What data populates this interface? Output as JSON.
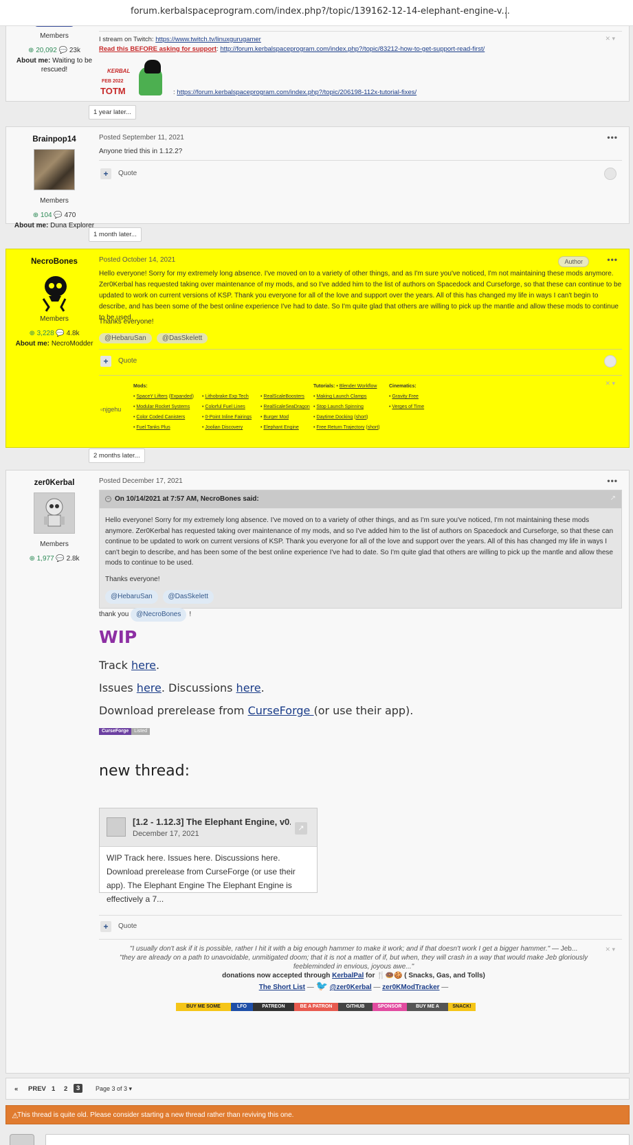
{
  "browser": {
    "url": "forum.kerbalspaceprogram.com/index.php?/topic/139162-12-14-elephant-engine-v..."
  },
  "post0": {
    "group": "Members",
    "rep": "20,092",
    "posts": "23k",
    "about_label": "About me:",
    "about": "Waiting to be rescued!",
    "sig_stream_prefix": "I stream on Twitch:",
    "sig_stream_link": "https://www.twitch.tv/linuxgurugamer",
    "sig_support_label": "Read this BEFORE asking for support",
    "sig_support_link": "http://forum.kerbalspaceprogram.com/index.php?/topic/83212-how-to-get-support-read-first/",
    "totm_top": "KERBAL",
    "totm_date": "FEB 2022",
    "totm_label": "TOTM",
    "sig_tutorial_link": "https://forum.kerbalspaceprogram.com/index.php?/topic/206198-112x-tutorial-fixes/"
  },
  "sep1": "1 year later...",
  "post1": {
    "author": "Brainpop14",
    "group": "Members",
    "rep": "104",
    "posts": "470",
    "about_label": "About me:",
    "about": "Duna Explorer",
    "meta": "Posted September 11, 2021",
    "text": "Anyone tried this in 1.12.2?",
    "quote": "Quote"
  },
  "sep2": "1 month later...",
  "post2": {
    "author": "NecroBones",
    "group": "Members",
    "rep": "3,228",
    "posts": "4.8k",
    "about_label": "About me:",
    "about": "NecroModder",
    "meta": "Posted October 14, 2021",
    "badge": "Author",
    "text": "Hello everyone! Sorry for my extremely long absence. I've moved on to a variety of other things, and as I'm sure you've noticed, I'm not maintaining these mods anymore. Zer0Kerbal has requested taking over maintenance of my mods, and so I've added him to the list of authors on Spacedock and Curseforge, so that these can continue to be updated to work on current versions of KSP. Thank you everyone for all of the love and support over the years. All of this has changed my life in ways I can't begin to describe, and has been some of the best online experience I've had to date. So I'm quite glad that others are willing to pick up the mantle and allow these mods to continue to be used.",
    "thanks": "Thanks everyone!",
    "mentions": [
      "@HebaruSan",
      "@DasSkelett"
    ],
    "quote": "Quote",
    "sig_img_alt": "njgehu",
    "mods_label": "Mods:",
    "mods_col1": [
      "SpaceY Lifters",
      "Modular Rocket Systems",
      "Color Coded Canisters",
      "Fuel Tanks Plus"
    ],
    "mods_col1_expanded": "Expanded",
    "mods_col2": [
      "Lithobrake Exp Tech",
      "Colorful Fuel Lines",
      "0-Point Inline Fairings",
      "Joolian Discovery"
    ],
    "mods_col3": [
      "RealScaleBoosters",
      "RealScaleSeaDragon",
      "Burger Mod",
      "Elephant Engine"
    ],
    "tutorials_label": "Tutorials:",
    "tutorials_first": "Blender Workflow",
    "tutorials": [
      "Making Launch Clamps",
      "Stop Launch Spinning",
      "Daytime Docking",
      "Free Return Trajectory"
    ],
    "short_label": "short",
    "cinematics_label": "Cinematics:",
    "cinematics": [
      "Gravity Free",
      "Verges of Time"
    ]
  },
  "sep3": "2 months later...",
  "post3": {
    "author": "zer0Kerbal",
    "group": "Members",
    "rep": "1,977",
    "posts": "2.8k",
    "meta": "Posted December 17, 2021",
    "bq_date": "On 10/14/2021 at 7:57 AM,",
    "bq_author": "NecroBones said:",
    "bq_text": "Hello everyone! Sorry for my extremely long absence. I've moved on to a variety of other things, and as I'm sure you've noticed, I'm not maintaining these mods anymore. Zer0Kerbal has requested taking over maintenance of my mods, and so I've added him to the list of authors on Spacedock and Curseforge, so that these can continue to be updated to work on current versions of KSP. Thank you everyone for all of the love and support over the years. All of this has changed my life in ways I can't begin to describe, and has been some of the best online experience I've had to date. So I'm quite glad that others are willing to pick up the mantle and allow these mods to continue to be used.",
    "bq_thanks": "Thanks everyone!",
    "bq_mentions": [
      "@HebaruSan",
      "@DasSkelett"
    ],
    "thankyou": "thank you",
    "thankyou_mention": "@NecroBones",
    "thankyou_end": "!",
    "wip": "WIP",
    "track_pre": "Track ",
    "here": "here",
    "track_post": ".",
    "issues_pre": "Issues ",
    "issues_mid": ". Discussions ",
    "curse_pre": "Download prerelease from ",
    "curse_link": "CurseForge ",
    "curse_post": "(or use their app).",
    "cf_badge": "CurseForge",
    "cf_listed": "Listed",
    "newthread": "new thread:",
    "embed_title": "[1.2 - 1.12.3] The Elephant Engine, v0.2....",
    "embed_date": "December 17, 2021",
    "embed_body": "WIP Track here. Issues here. Discussions here. Download prerelease from CurseForge (or use their app).   The Elephant Engine    The Elephant Engine is effectively a 7...",
    "quote": "Quote",
    "sig_quote1": "\"I usually don't ask if it is possible, rather I hit it with a big enough hammer to make it work; and if that doesn't work I get a bigger hammer.\"",
    "sig_quote1_by": " — Jeb...",
    "sig_quote2": "\"they are already on a path to unavoidable, unmitigated doom; that it is not a matter of if, but when, they will crash in a way that would make Jeb gloriously feebleminded in envious, joyous awe...\"",
    "sig_donations_pre": "donations now accepted through ",
    "sig_kerbalpal": "KerbalPal",
    "sig_donations_post": " for 🍴🍩🍪 ( Snacks, Gas, and Tolls)",
    "sig_shortlist": "The Short List",
    "sig_twitter": "@zer0Kerbal",
    "sig_tracker": "zer0KModTracker",
    "sig_badges": [
      {
        "label": "BUY ME SOME",
        "color": "#f5c518"
      },
      {
        "label": "LFO",
        "color": "#1f4fa8"
      },
      {
        "label": "PATREON",
        "color": "#333333"
      },
      {
        "label": "BE A PATRON",
        "color": "#e85a4f"
      },
      {
        "label": "GITHUB",
        "color": "#444444"
      },
      {
        "label": "SPONSOR",
        "color": "#e24ba0"
      },
      {
        "label": "BUY ME A",
        "color": "#555555"
      },
      {
        "label": "SNACK!",
        "color": "#f5c518"
      }
    ]
  },
  "pager": {
    "prev_arrow": "«",
    "prev": "PREV",
    "pages": [
      "1",
      "2",
      "3"
    ],
    "page_of": "Page 3 of 3 ▾"
  },
  "warning": "This thread is quite old. Please consider starting a new thread rather than reviving this one.",
  "colors": {
    "highlight": "#ffff00",
    "warning": "#e07b2f",
    "wip": "#8d2fa3",
    "reputation": "#2e8b57"
  }
}
